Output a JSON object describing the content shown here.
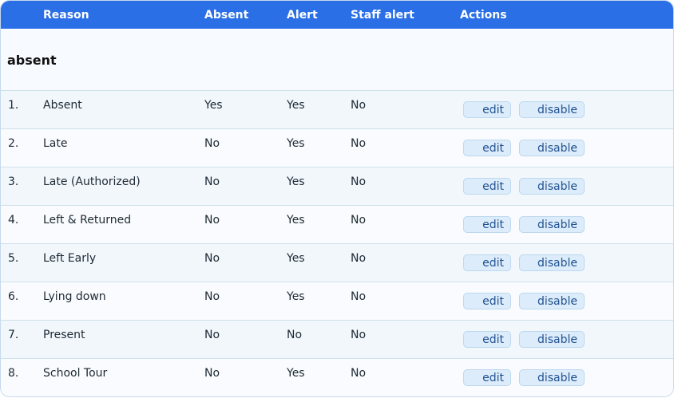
{
  "headers": {
    "reason": "Reason",
    "absent": "Absent",
    "alert": "Alert",
    "staff_alert": "Staff alert",
    "actions": "Actions"
  },
  "group": {
    "title": "absent"
  },
  "actions": {
    "edit_label": "edit",
    "disable_label": "disable"
  },
  "rows": [
    {
      "num": "1.",
      "reason": "Absent",
      "absent": "Yes",
      "alert": "Yes",
      "staff_alert": "No"
    },
    {
      "num": "2.",
      "reason": "Late",
      "absent": "No",
      "alert": "Yes",
      "staff_alert": "No"
    },
    {
      "num": "3.",
      "reason": "Late (Authorized)",
      "absent": "No",
      "alert": "Yes",
      "staff_alert": "No"
    },
    {
      "num": "4.",
      "reason": "Left & Returned",
      "absent": "No",
      "alert": "Yes",
      "staff_alert": "No"
    },
    {
      "num": "5.",
      "reason": "Left Early",
      "absent": "No",
      "alert": "Yes",
      "staff_alert": "No"
    },
    {
      "num": "6.",
      "reason": "Lying down",
      "absent": "No",
      "alert": "Yes",
      "staff_alert": "No"
    },
    {
      "num": "7.",
      "reason": "Present",
      "absent": "No",
      "alert": "No",
      "staff_alert": "No"
    },
    {
      "num": "8.",
      "reason": "School Tour",
      "absent": "No",
      "alert": "Yes",
      "staff_alert": "No"
    }
  ],
  "colors": {
    "header_bg": "#2a6fe6",
    "button_bg": "#dcecfb",
    "button_text": "#1f4f8f"
  }
}
